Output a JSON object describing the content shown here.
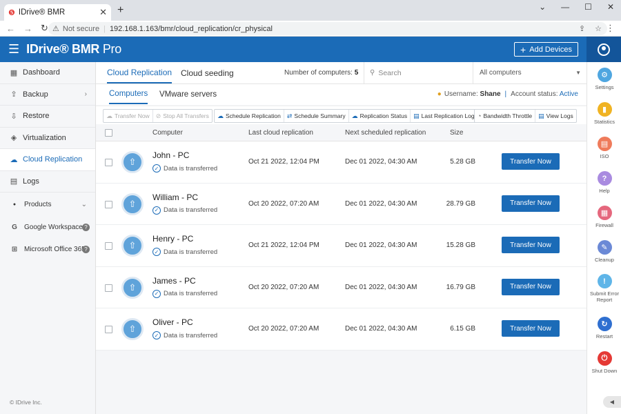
{
  "browser": {
    "tab_title": "IDrive® BMR",
    "tab_close": "✕",
    "new_tab": "+",
    "minimize": "⌄",
    "min": "—",
    "restore": "☐",
    "close": "✕",
    "not_secure": "Not secure",
    "url": "192.168.1.163/bmr/cloud_replication/cr_physical"
  },
  "header": {
    "logo_main": "IDrive® BMR",
    "logo_pro": " Pro",
    "add_devices": "Add Devices"
  },
  "sidebar": {
    "items": [
      {
        "label": "Dashboard",
        "icon": "dashboard-icon"
      },
      {
        "label": "Backup",
        "icon": "backup-icon"
      },
      {
        "label": "Restore",
        "icon": "restore-icon"
      },
      {
        "label": "Virtualization",
        "icon": "layers-icon"
      },
      {
        "label": "Cloud Replication",
        "icon": "cloud-icon"
      },
      {
        "label": "Logs",
        "icon": "logs-icon"
      }
    ],
    "products_label": "Products",
    "products": [
      {
        "label": "Google Workspace",
        "icon": "google-icon"
      },
      {
        "label": "Microsoft Office 365",
        "icon": "windows-icon"
      }
    ],
    "copyright": "© IDrive Inc."
  },
  "tabs": {
    "cloud_replication": "Cloud Replication",
    "cloud_seeding": "Cloud seeding",
    "num_label": "Number of computers:",
    "num_value": "5",
    "search_placeholder": "Search",
    "filter": "All computers"
  },
  "subtabs": {
    "computers": "Computers",
    "vmware": "VMware servers",
    "username_label": "Username:",
    "username": "Shane",
    "status_label": "Account status:",
    "status": "Active"
  },
  "toolbar": {
    "transfer_now": "Transfer Now",
    "stop_all": "Stop All Transfers",
    "schedule_replication": "Schedule Replication",
    "schedule_summary": "Schedule Summary",
    "replication_status": "Replication Status",
    "last_log": "Last Replication Log",
    "bandwidth": "Bandwidth Throttle",
    "view_logs": "View Logs"
  },
  "table": {
    "headers": {
      "computer": "Computer",
      "last": "Last cloud replication",
      "next": "Next scheduled replication",
      "size": "Size"
    },
    "rows": [
      {
        "name": "John - PC",
        "status": "Data is transferred",
        "last": "Oct 21 2022, 12:04 PM",
        "next": "Dec 01 2022, 04:30 AM",
        "size": "5.28 GB",
        "action": "Transfer Now"
      },
      {
        "name": "William - PC",
        "status": "Data is transferred",
        "last": "Oct 20 2022, 07:20 AM",
        "next": "Dec 01 2022, 04:30 AM",
        "size": "28.79 GB",
        "action": "Transfer Now"
      },
      {
        "name": "Henry - PC",
        "status": "Data is transferred",
        "last": "Oct 21 2022, 12:04 PM",
        "next": "Dec 01 2022, 04:30 AM",
        "size": "15.28 GB",
        "action": "Transfer Now"
      },
      {
        "name": "James - PC",
        "status": "Data is transferred",
        "last": "Oct 20 2022, 07:20 AM",
        "next": "Dec 01 2022, 04:30 AM",
        "size": "16.79 GB",
        "action": "Transfer Now"
      },
      {
        "name": "Oliver - PC",
        "status": "Data is transferred",
        "last": "Oct 20 2022, 07:20 AM",
        "next": "Dec 01 2022, 04:30 AM",
        "size": "6.15 GB",
        "action": "Transfer Now"
      }
    ]
  },
  "rail": {
    "items": [
      {
        "label": "Settings",
        "color": "#4fa6e0",
        "icon": "gear-icon",
        "glyph": "⚙"
      },
      {
        "label": "Statistics",
        "color": "#f0b323",
        "icon": "chart-icon",
        "glyph": "▮"
      },
      {
        "label": "ISO",
        "color": "#ef7b5b",
        "icon": "iso-icon",
        "glyph": "▤"
      },
      {
        "label": "Help",
        "color": "#a98be0",
        "icon": "help-icon",
        "glyph": "?"
      },
      {
        "label": "Firewall",
        "color": "#e5677d",
        "icon": "firewall-icon",
        "glyph": "▦"
      },
      {
        "label": "Cleanup",
        "color": "#6b89d6",
        "icon": "cleanup-icon",
        "glyph": "✎"
      },
      {
        "label": "Submit Error Report",
        "color": "#5fb5e8",
        "icon": "warning-icon",
        "glyph": "!"
      },
      {
        "label": "Restart",
        "color": "#2f6fd0",
        "icon": "restart-icon",
        "glyph": "↻"
      },
      {
        "label": "Shut Down",
        "color": "#e53935",
        "icon": "power-icon",
        "glyph": "⏻"
      }
    ]
  },
  "colors": {
    "brand": "#1b6bb7"
  }
}
